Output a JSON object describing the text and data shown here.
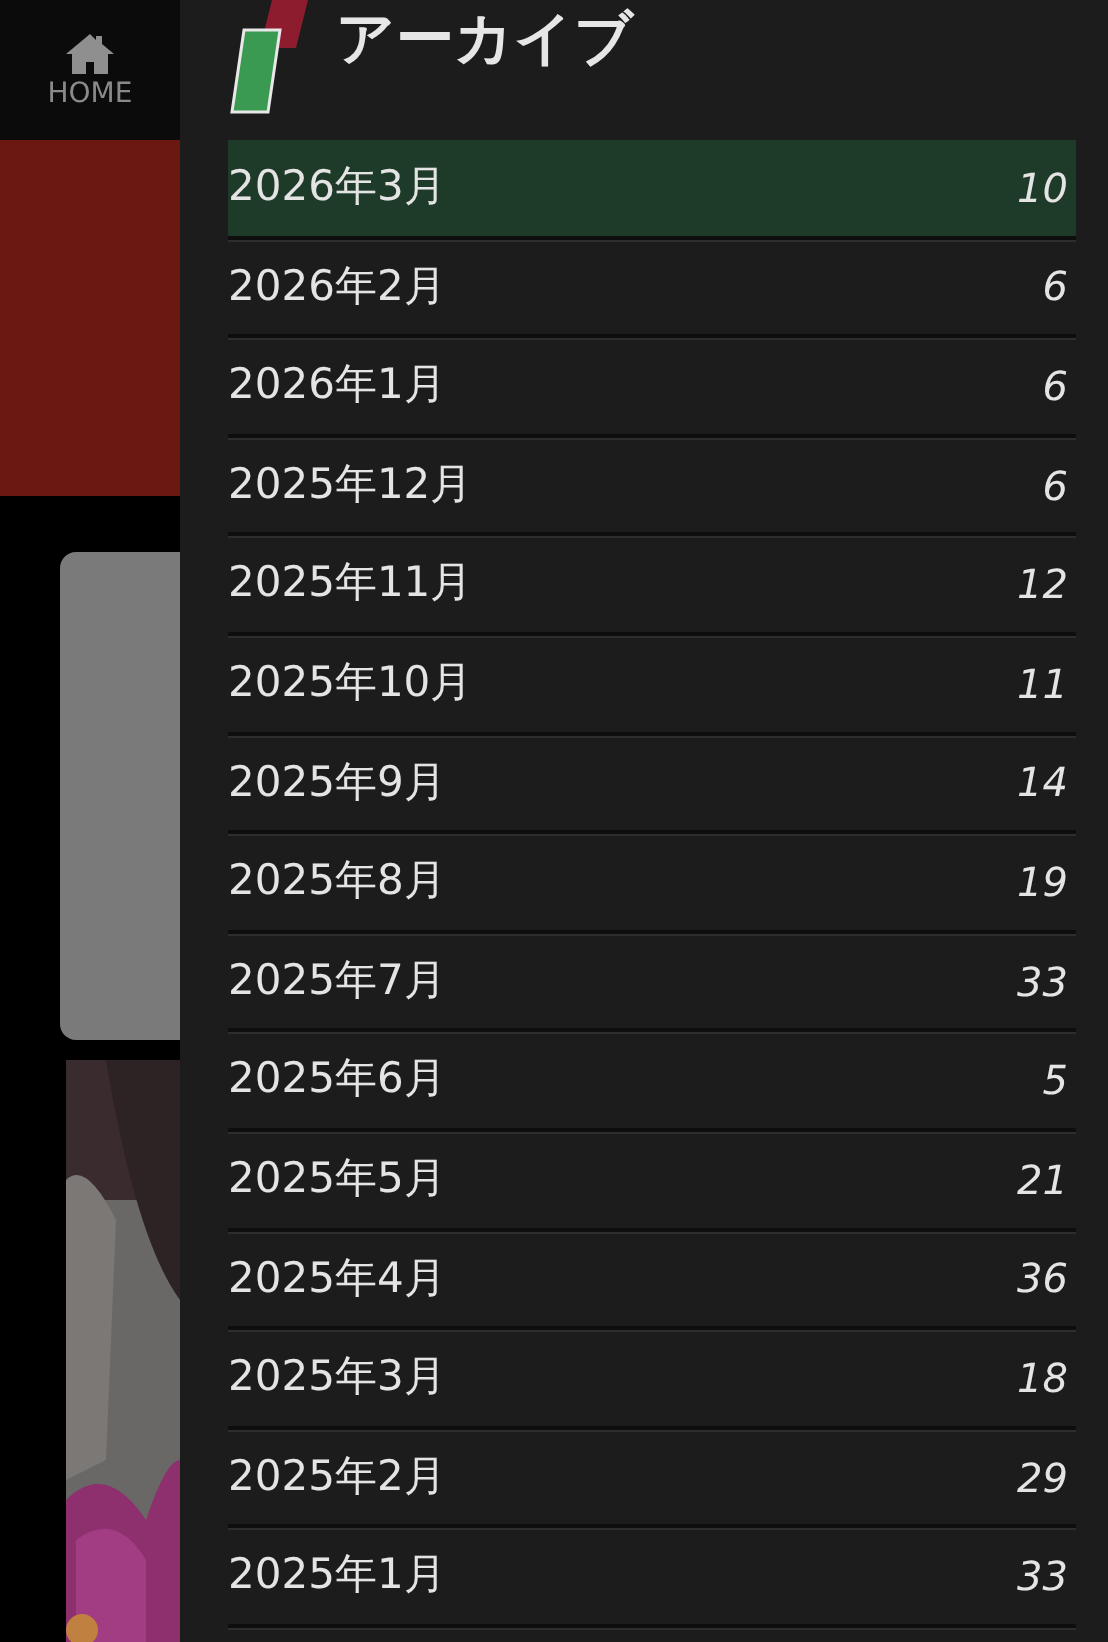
{
  "nav": {
    "home_label": "HOME"
  },
  "archive": {
    "title": "アーカイブ",
    "items": [
      {
        "label": "2026年3月",
        "count": "10",
        "selected": true
      },
      {
        "label": "2026年2月",
        "count": "6",
        "selected": false
      },
      {
        "label": "2026年1月",
        "count": "6",
        "selected": false
      },
      {
        "label": "2025年12月",
        "count": "6",
        "selected": false
      },
      {
        "label": "2025年11月",
        "count": "12",
        "selected": false
      },
      {
        "label": "2025年10月",
        "count": "11",
        "selected": false
      },
      {
        "label": "2025年9月",
        "count": "14",
        "selected": false
      },
      {
        "label": "2025年8月",
        "count": "19",
        "selected": false
      },
      {
        "label": "2025年7月",
        "count": "33",
        "selected": false
      },
      {
        "label": "2025年6月",
        "count": "5",
        "selected": false
      },
      {
        "label": "2025年5月",
        "count": "21",
        "selected": false
      },
      {
        "label": "2025年4月",
        "count": "36",
        "selected": false
      },
      {
        "label": "2025年3月",
        "count": "18",
        "selected": false
      },
      {
        "label": "2025年2月",
        "count": "29",
        "selected": false
      },
      {
        "label": "2025年1月",
        "count": "33",
        "selected": false
      }
    ]
  }
}
